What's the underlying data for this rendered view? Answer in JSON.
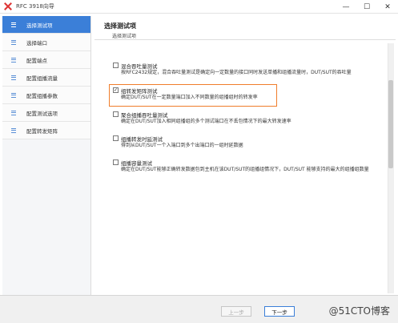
{
  "window": {
    "title": "RFC 3918向导",
    "controls": {
      "minimize": "—",
      "maximize": "☐",
      "close": "✕"
    },
    "accent_color": "#3b7fd8"
  },
  "sidebar": {
    "items": [
      {
        "label": "选择测试项",
        "active": true
      },
      {
        "label": "选择端口"
      },
      {
        "label": "配置端点"
      },
      {
        "label": "配置组播流量"
      },
      {
        "label": "配置组播参数"
      },
      {
        "label": "配置测试选项"
      },
      {
        "label": "配置转发矩阵"
      }
    ]
  },
  "header": {
    "title": "选择测试项",
    "subtitle": "选择测试项"
  },
  "options": [
    {
      "name": "混合吞吐量测试",
      "checked": false,
      "desc": "按RFC2432规定，混合吞吐量测试是确定向一定数量的接口同时发送单播和组播流量时，DUT/SUT的吞吐量"
    },
    {
      "name": "组转发矩阵测试",
      "checked": true,
      "desc": "确定DUT/SUT在一定数量端口加入不同数量的组播组时的转发率"
    },
    {
      "name": "聚合组播吞吐量测试",
      "checked": false,
      "desc": "确定在DUT/SUT加入相同组播组的多个测试端口在不丢包情况下的最大转发速率"
    },
    {
      "name": "组播转发时延测试",
      "checked": false,
      "desc": "得到从DUT/SUT一个入端口到多个出端口的一组时延数据"
    },
    {
      "name": "组播容量测试",
      "checked": false,
      "desc": "确定在DUT/SUT能够正确转发数据包到主机在该DUT/SUT的组播组情况下，DUT/SUT 能够支持的最大的组播组数量"
    }
  ],
  "highlight_color": "#f07d2b",
  "footer": {
    "prev_label": "上一步",
    "next_label": "下一步",
    "watermark": "@51CTO博客"
  }
}
